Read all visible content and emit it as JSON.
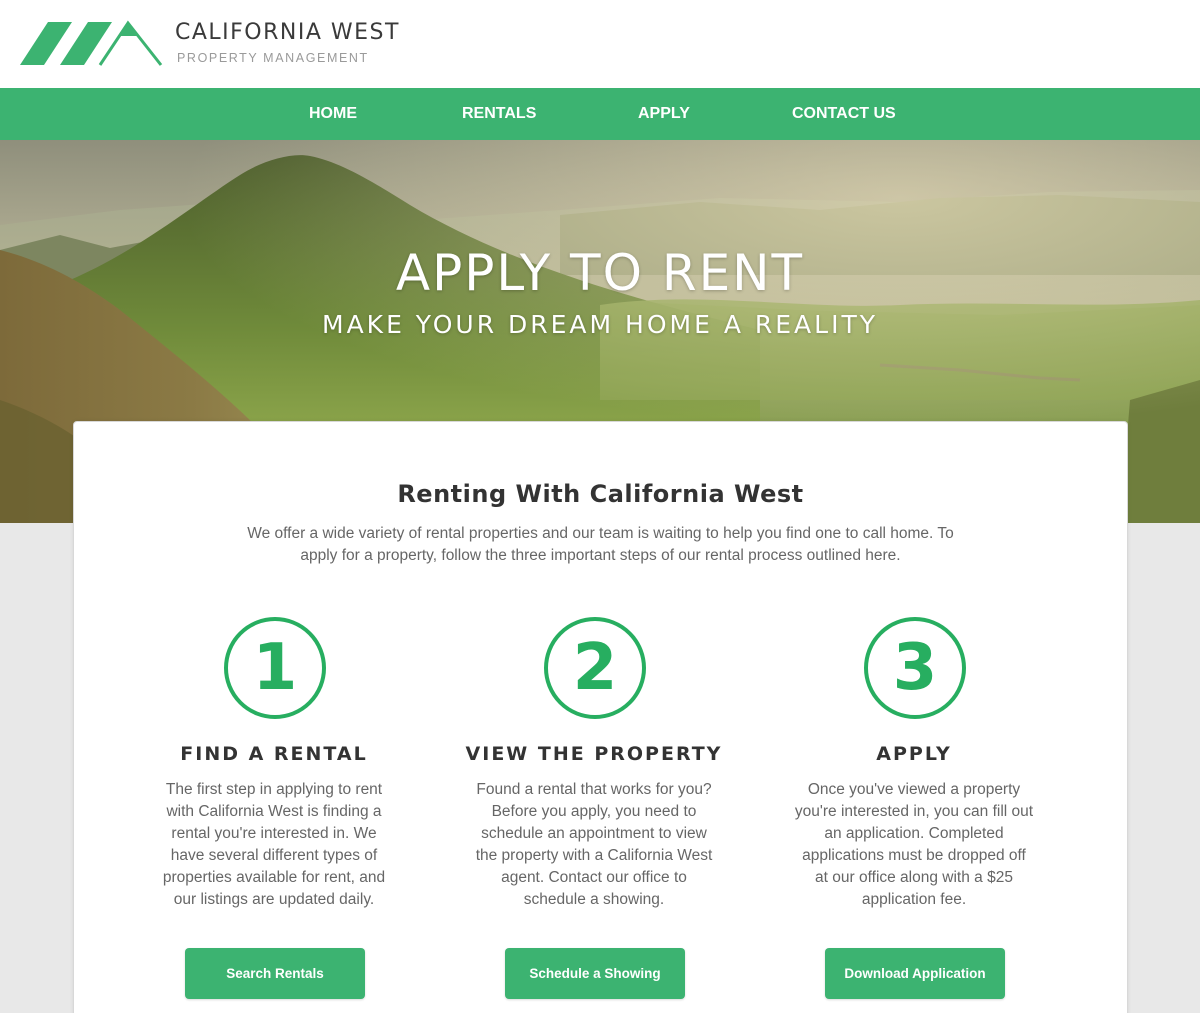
{
  "brand": {
    "name": "CALIFORNIA WEST",
    "tagline": "PROPERTY MANAGEMENT",
    "logo_icon": "house-roof-logo",
    "color": "#3cb371"
  },
  "nav": {
    "items": [
      {
        "label": "HOME"
      },
      {
        "label": "RENTALS"
      },
      {
        "label": "APPLY"
      },
      {
        "label": "CONTACT US"
      }
    ]
  },
  "hero": {
    "title": "APPLY TO RENT",
    "subtitle": "MAKE YOUR DREAM HOME A REALITY"
  },
  "main": {
    "title": "Renting With California West",
    "intro": "We offer a wide variety of rental properties and our team is waiting to help you find one to call home. To apply for a property, follow the three important steps of our rental process outlined here.",
    "steps": [
      {
        "number": "1",
        "title": "FIND A RENTAL",
        "text": "The first step in applying to rent with California West is finding a rental you're interested in. We have several different types of properties available for rent, and our listings are updated daily.",
        "button": "Search Rentals"
      },
      {
        "number": "2",
        "title": "VIEW THE PROPERTY",
        "text": "Found a rental that works for you? Before you apply, you need to schedule an appointment to view the property with a California West agent. Contact our office to schedule a showing.",
        "button": "Schedule a Showing"
      },
      {
        "number": "3",
        "title": "APPLY",
        "text": "Once you've viewed a property you're interested in, you can fill out an application. Completed applications must be dropped off at our office along with a $25 application fee.",
        "button": "Download Application"
      }
    ]
  },
  "colors": {
    "accent": "#3cb371",
    "step_circle": "#27ae60",
    "heading": "#333333",
    "body_text": "#666666",
    "page_bg": "#e8e8e8"
  }
}
